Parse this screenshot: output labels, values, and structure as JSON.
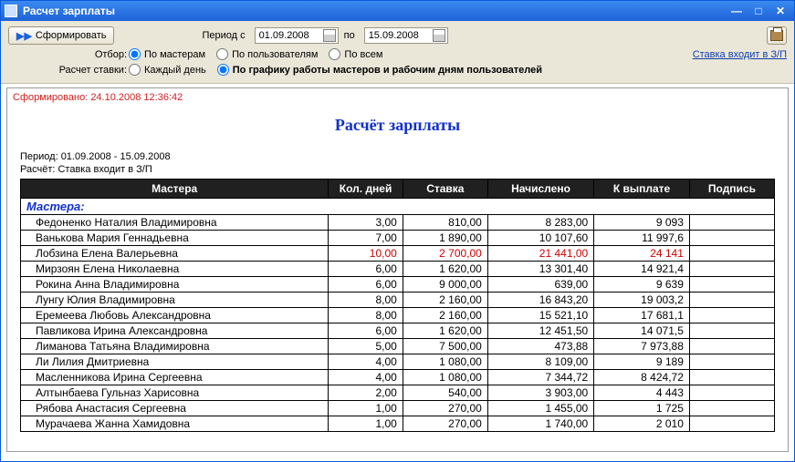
{
  "window": {
    "title": "Расчет зарплаты"
  },
  "toolbar": {
    "form_button": "Сформировать",
    "period_from_label": "Период с",
    "period_from": "01.09.2008",
    "period_to_label": "по",
    "period_to": "15.09.2008",
    "filter_label": "Отбор:",
    "filter_masters": "По мастерам",
    "filter_users": "По пользователям",
    "filter_all": "По всем",
    "rate_in_zp": "Ставка входит в З/П",
    "calc_label": "Расчет ставки:",
    "calc_daily": "Каждый день",
    "calc_schedule": "По графику работы мастеров и рабочим дням пользователей"
  },
  "report": {
    "formed_at": "Сформировано: 24.10.2008 12:36:42",
    "title": "Расчёт зарплаты",
    "period_line": "Период: 01.09.2008 - 15.09.2008",
    "calc_line": "Расчёт: Ставка входит в З/П",
    "headers": {
      "name": "Мастера",
      "days": "Кол. дней",
      "rate": "Ставка",
      "accrued": "Начислено",
      "payable": "К выплате",
      "sign": "Подпись"
    },
    "section": "Мастера:",
    "rows": [
      {
        "name": "Федоненко Наталия Владимировна",
        "days": "3,00",
        "rate": "810,00",
        "accrued": "8 283,00",
        "payable": "9 093"
      },
      {
        "name": "Ванькова Мария Геннадьевна",
        "days": "7,00",
        "rate": "1 890,00",
        "accrued": "10 107,60",
        "payable": "11 997,6"
      },
      {
        "name": "Лобзина Елена Валерьевна",
        "days": "10,00",
        "rate": "2 700,00",
        "accrued": "21 441,00",
        "payable": "24 141",
        "red": true
      },
      {
        "name": "Мирзоян Елена Николаевна",
        "days": "6,00",
        "rate": "1 620,00",
        "accrued": "13 301,40",
        "payable": "14 921,4"
      },
      {
        "name": "Рокина Анна Владимировна",
        "days": "6,00",
        "rate": "9 000,00",
        "accrued": "639,00",
        "payable": "9 639"
      },
      {
        "name": "Лунгу Юлия Владимировна",
        "days": "8,00",
        "rate": "2 160,00",
        "accrued": "16 843,20",
        "payable": "19 003,2"
      },
      {
        "name": "Еремеева Любовь Александровна",
        "days": "8,00",
        "rate": "2 160,00",
        "accrued": "15 521,10",
        "payable": "17 681,1"
      },
      {
        "name": "Павликова Ирина Александровна",
        "days": "6,00",
        "rate": "1 620,00",
        "accrued": "12 451,50",
        "payable": "14 071,5"
      },
      {
        "name": "Лиманова  Татьяна  Владимировна",
        "days": "5,00",
        "rate": "7 500,00",
        "accrued": "473,88",
        "payable": "7 973,88"
      },
      {
        "name": "Ли Лилия Дмитриевна",
        "days": "4,00",
        "rate": "1 080,00",
        "accrued": "8 109,00",
        "payable": "9 189"
      },
      {
        "name": "Масленникова Ирина Сергеевна",
        "days": "4,00",
        "rate": "1 080,00",
        "accrued": "7 344,72",
        "payable": "8 424,72"
      },
      {
        "name": "Алтынбаева Гульназ Харисовна",
        "days": "2,00",
        "rate": "540,00",
        "accrued": "3 903,00",
        "payable": "4 443"
      },
      {
        "name": "Рябова Анастасия Сергеевна",
        "days": "1,00",
        "rate": "270,00",
        "accrued": "1 455,00",
        "payable": "1 725"
      },
      {
        "name": "Мурачаева Жанна Хамидовна",
        "days": "1,00",
        "rate": "270,00",
        "accrued": "1 740,00",
        "payable": "2 010"
      }
    ]
  }
}
